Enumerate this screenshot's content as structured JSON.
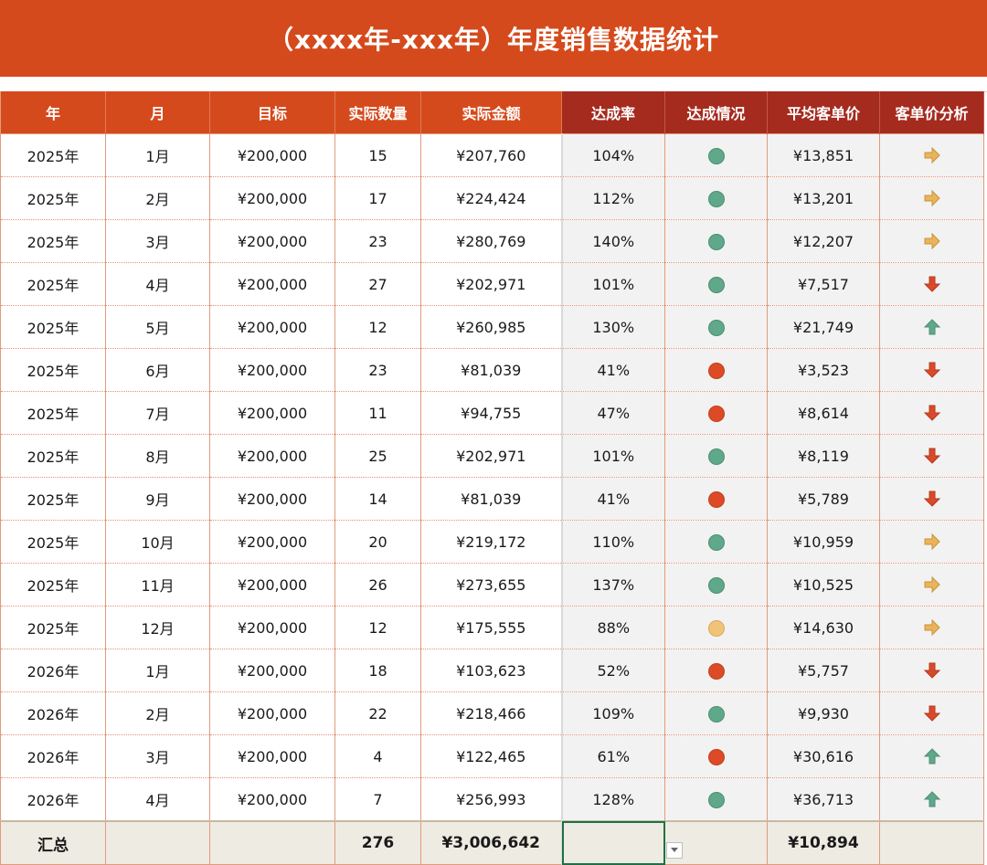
{
  "title": "（xxxx年-xxx年）年度销售数据统计",
  "headers": [
    "年",
    "月",
    "目标",
    "实际数量",
    "实际金额",
    "达成率",
    "达成情况",
    "平均客单价",
    "客单价分析"
  ],
  "rows": [
    {
      "year": "2025年",
      "month": "1月",
      "target": "¥200,000",
      "qty": "15",
      "amount": "¥207,760",
      "rate": "104%",
      "status": "green",
      "avg": "¥13,851",
      "trend": "right-arrow-icon"
    },
    {
      "year": "2025年",
      "month": "2月",
      "target": "¥200,000",
      "qty": "17",
      "amount": "¥224,424",
      "rate": "112%",
      "status": "green",
      "avg": "¥13,201",
      "trend": "right-arrow-icon"
    },
    {
      "year": "2025年",
      "month": "3月",
      "target": "¥200,000",
      "qty": "23",
      "amount": "¥280,769",
      "rate": "140%",
      "status": "green",
      "avg": "¥12,207",
      "trend": "right-arrow-icon"
    },
    {
      "year": "2025年",
      "month": "4月",
      "target": "¥200,000",
      "qty": "27",
      "amount": "¥202,971",
      "rate": "101%",
      "status": "green",
      "avg": "¥7,517",
      "trend": "down-arrow-icon"
    },
    {
      "year": "2025年",
      "month": "5月",
      "target": "¥200,000",
      "qty": "12",
      "amount": "¥260,985",
      "rate": "130%",
      "status": "green",
      "avg": "¥21,749",
      "trend": "up-arrow-icon"
    },
    {
      "year": "2025年",
      "month": "6月",
      "target": "¥200,000",
      "qty": "23",
      "amount": "¥81,039",
      "rate": "41%",
      "status": "red",
      "avg": "¥3,523",
      "trend": "down-arrow-icon"
    },
    {
      "year": "2025年",
      "month": "7月",
      "target": "¥200,000",
      "qty": "11",
      "amount": "¥94,755",
      "rate": "47%",
      "status": "red",
      "avg": "¥8,614",
      "trend": "down-arrow-icon"
    },
    {
      "year": "2025年",
      "month": "8月",
      "target": "¥200,000",
      "qty": "25",
      "amount": "¥202,971",
      "rate": "101%",
      "status": "green",
      "avg": "¥8,119",
      "trend": "down-arrow-icon"
    },
    {
      "year": "2025年",
      "month": "9月",
      "target": "¥200,000",
      "qty": "14",
      "amount": "¥81,039",
      "rate": "41%",
      "status": "red",
      "avg": "¥5,789",
      "trend": "down-arrow-icon"
    },
    {
      "year": "2025年",
      "month": "10月",
      "target": "¥200,000",
      "qty": "20",
      "amount": "¥219,172",
      "rate": "110%",
      "status": "green",
      "avg": "¥10,959",
      "trend": "right-arrow-icon"
    },
    {
      "year": "2025年",
      "month": "11月",
      "target": "¥200,000",
      "qty": "26",
      "amount": "¥273,655",
      "rate": "137%",
      "status": "green",
      "avg": "¥10,525",
      "trend": "right-arrow-icon"
    },
    {
      "year": "2025年",
      "month": "12月",
      "target": "¥200,000",
      "qty": "12",
      "amount": "¥175,555",
      "rate": "88%",
      "status": "yellow",
      "avg": "¥14,630",
      "trend": "right-arrow-icon"
    },
    {
      "year": "2026年",
      "month": "1月",
      "target": "¥200,000",
      "qty": "18",
      "amount": "¥103,623",
      "rate": "52%",
      "status": "red",
      "avg": "¥5,757",
      "trend": "down-arrow-icon"
    },
    {
      "year": "2026年",
      "month": "2月",
      "target": "¥200,000",
      "qty": "22",
      "amount": "¥218,466",
      "rate": "109%",
      "status": "green",
      "avg": "¥9,930",
      "trend": "down-arrow-icon"
    },
    {
      "year": "2026年",
      "month": "3月",
      "target": "¥200,000",
      "qty": "4",
      "amount": "¥122,465",
      "rate": "61%",
      "status": "red",
      "avg": "¥30,616",
      "trend": "up-arrow-icon"
    },
    {
      "year": "2026年",
      "month": "4月",
      "target": "¥200,000",
      "qty": "7",
      "amount": "¥256,993",
      "rate": "128%",
      "status": "green",
      "avg": "¥36,713",
      "trend": "up-arrow-icon"
    }
  ],
  "totals": {
    "label": "汇总",
    "qty": "276",
    "amount": "¥3,006,642",
    "avg": "¥10,894"
  },
  "colors": {
    "title_bg": "#D54A1C",
    "header_bg": "#D54A1C",
    "header_dark_bg": "#A52B1F",
    "status_green": "#5FA88A",
    "status_red": "#DD4B26",
    "status_yellow": "#EFC478",
    "arrow_right": "#E9B45A",
    "arrow_down": "#D9492A",
    "arrow_up": "#5FA88A"
  }
}
